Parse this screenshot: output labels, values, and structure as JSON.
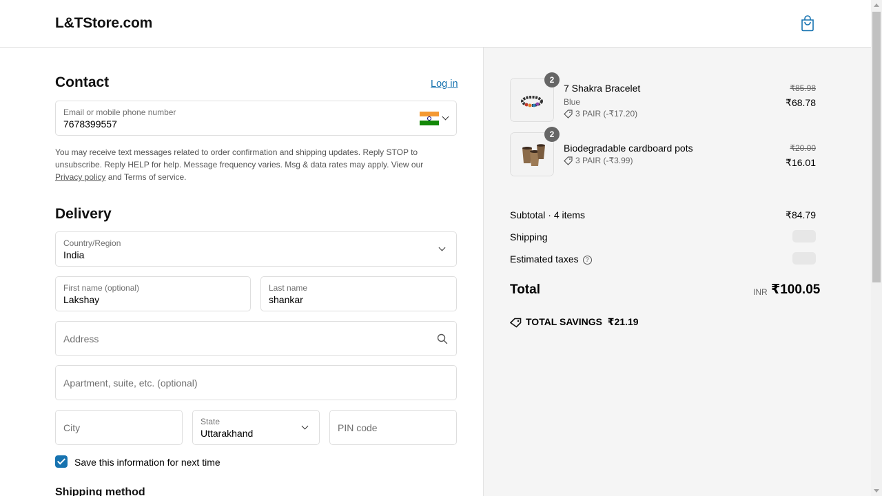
{
  "header": {
    "brand": "L&TStore.com",
    "cart_icon": "shopping-bag-icon"
  },
  "contact": {
    "title": "Contact",
    "login_link": "Log in",
    "phone_field": {
      "label": "Email or mobile phone number",
      "value": "7678399557",
      "country_flag": "india-flag-icon"
    },
    "notice_part1": "You may receive text messages related to order confirmation and shipping updates. Reply STOP to unsubscribe. Reply HELP for help. Message frequency varies. Msg & data rates may apply. View our ",
    "privacy_link": "Privacy policy",
    "notice_part2": " and Terms of service."
  },
  "delivery": {
    "title": "Delivery",
    "country": {
      "label": "Country/Region",
      "value": "India"
    },
    "first_name": {
      "label": "First name (optional)",
      "value": "Lakshay"
    },
    "last_name": {
      "label": "Last name",
      "value": "shankar"
    },
    "address": {
      "placeholder": "Address"
    },
    "apartment": {
      "placeholder": "Apartment, suite, etc. (optional)"
    },
    "city": {
      "placeholder": "City"
    },
    "state": {
      "label": "State",
      "value": "Uttarakhand"
    },
    "pin": {
      "placeholder": "PIN code"
    },
    "save_info": {
      "label": "Save this information for next time",
      "checked": true
    }
  },
  "shipping_method": {
    "title": "Shipping method"
  },
  "summary": {
    "items": [
      {
        "name": "7 Shakra Bracelet",
        "variant": "Blue",
        "quantity": "2",
        "discount": "3 PAIR (-₹17.20)",
        "old_price": "₹85.98",
        "price": "₹68.78"
      },
      {
        "name": "Biodegradable cardboard pots",
        "variant": "",
        "quantity": "2",
        "discount": "3 PAIR (-₹3.99)",
        "old_price": "₹20.00",
        "price": "₹16.01"
      }
    ],
    "subtotal_label": "Subtotal · 4 items",
    "subtotal_value": "₹84.79",
    "shipping_label": "Shipping",
    "taxes_label": "Estimated taxes",
    "total_label": "Total",
    "currency": "INR",
    "total_value": "₹100.05",
    "savings_label": "TOTAL SAVINGS",
    "savings_value": "₹21.19"
  },
  "colors": {
    "accent": "#1773b0",
    "summary_bg": "#f5f5f5",
    "border": "#dedede"
  }
}
